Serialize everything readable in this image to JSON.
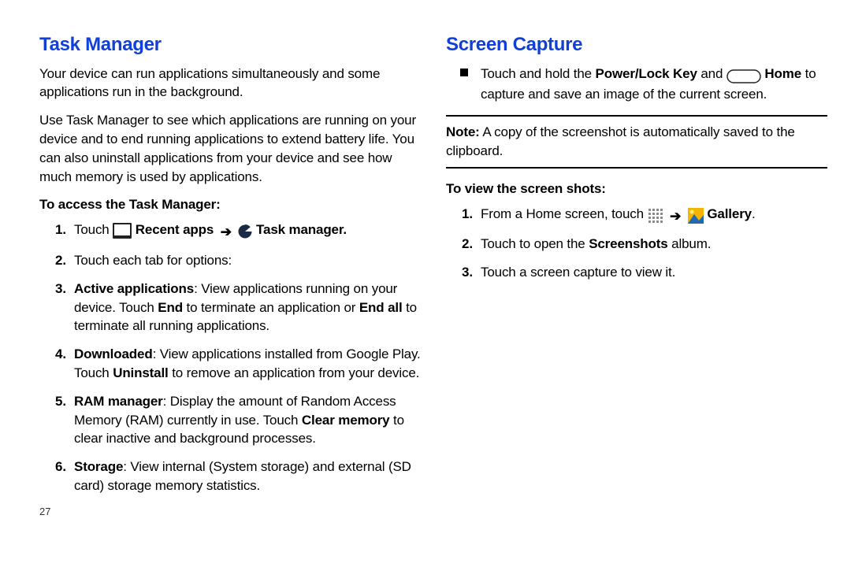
{
  "left": {
    "title": "Task Manager",
    "p1": "Your device can run applications simultaneously and some applications run in the background.",
    "p2": "Use Task Manager to see which applications are running on your device and to end running applications to extend battery life. You can also uninstall applications from your device and see how much memory is used by applications.",
    "sub": "To access the Task Manager:",
    "li1_a": "Touch ",
    "li1_b": " Recent apps",
    "li1_c": " Task manager.",
    "li2": "Touch each tab for options:",
    "li3_t": "Active applications",
    "li3_a": ": View applications running on your device. Touch ",
    "li3_b": "End",
    "li3_c": " to terminate an application or ",
    "li3_d": "End all",
    "li3_e": " to terminate all running applications.",
    "li4_t": "Downloaded",
    "li4_a": ": View applications installed from Google Play. Touch ",
    "li4_b": "Uninstall",
    "li4_c": " to remove an application from your device.",
    "li5_t": "RAM manager",
    "li5_a": ": Display the amount of Random Access Memory (RAM) currently in use. Touch ",
    "li5_b": "Clear memory",
    "li5_c": " to clear inactive and background processes.",
    "li6_t": "Storage",
    "li6_a": ": View internal (System storage) and external (SD card) storage memory statistics.",
    "pagenum": "27"
  },
  "right": {
    "title": "Screen Capture",
    "bul_a": "Touch and hold the ",
    "bul_b": "Power/Lock Key",
    "bul_c": " and ",
    "bul_d": " Home",
    "bul_e": " to capture and save an image of the current screen.",
    "note_a": "Note:",
    "note_b": " A copy of the screenshot is automatically saved to the clipboard.",
    "sub": "To view the screen shots:",
    "li1_a": "From a Home screen, touch ",
    "li1_b": " Gallery",
    "li1_c": ".",
    "li2_a": "Touch to open the ",
    "li2_b": "Screenshots",
    "li2_c": " album.",
    "li3": "Touch a screen capture to view it."
  }
}
